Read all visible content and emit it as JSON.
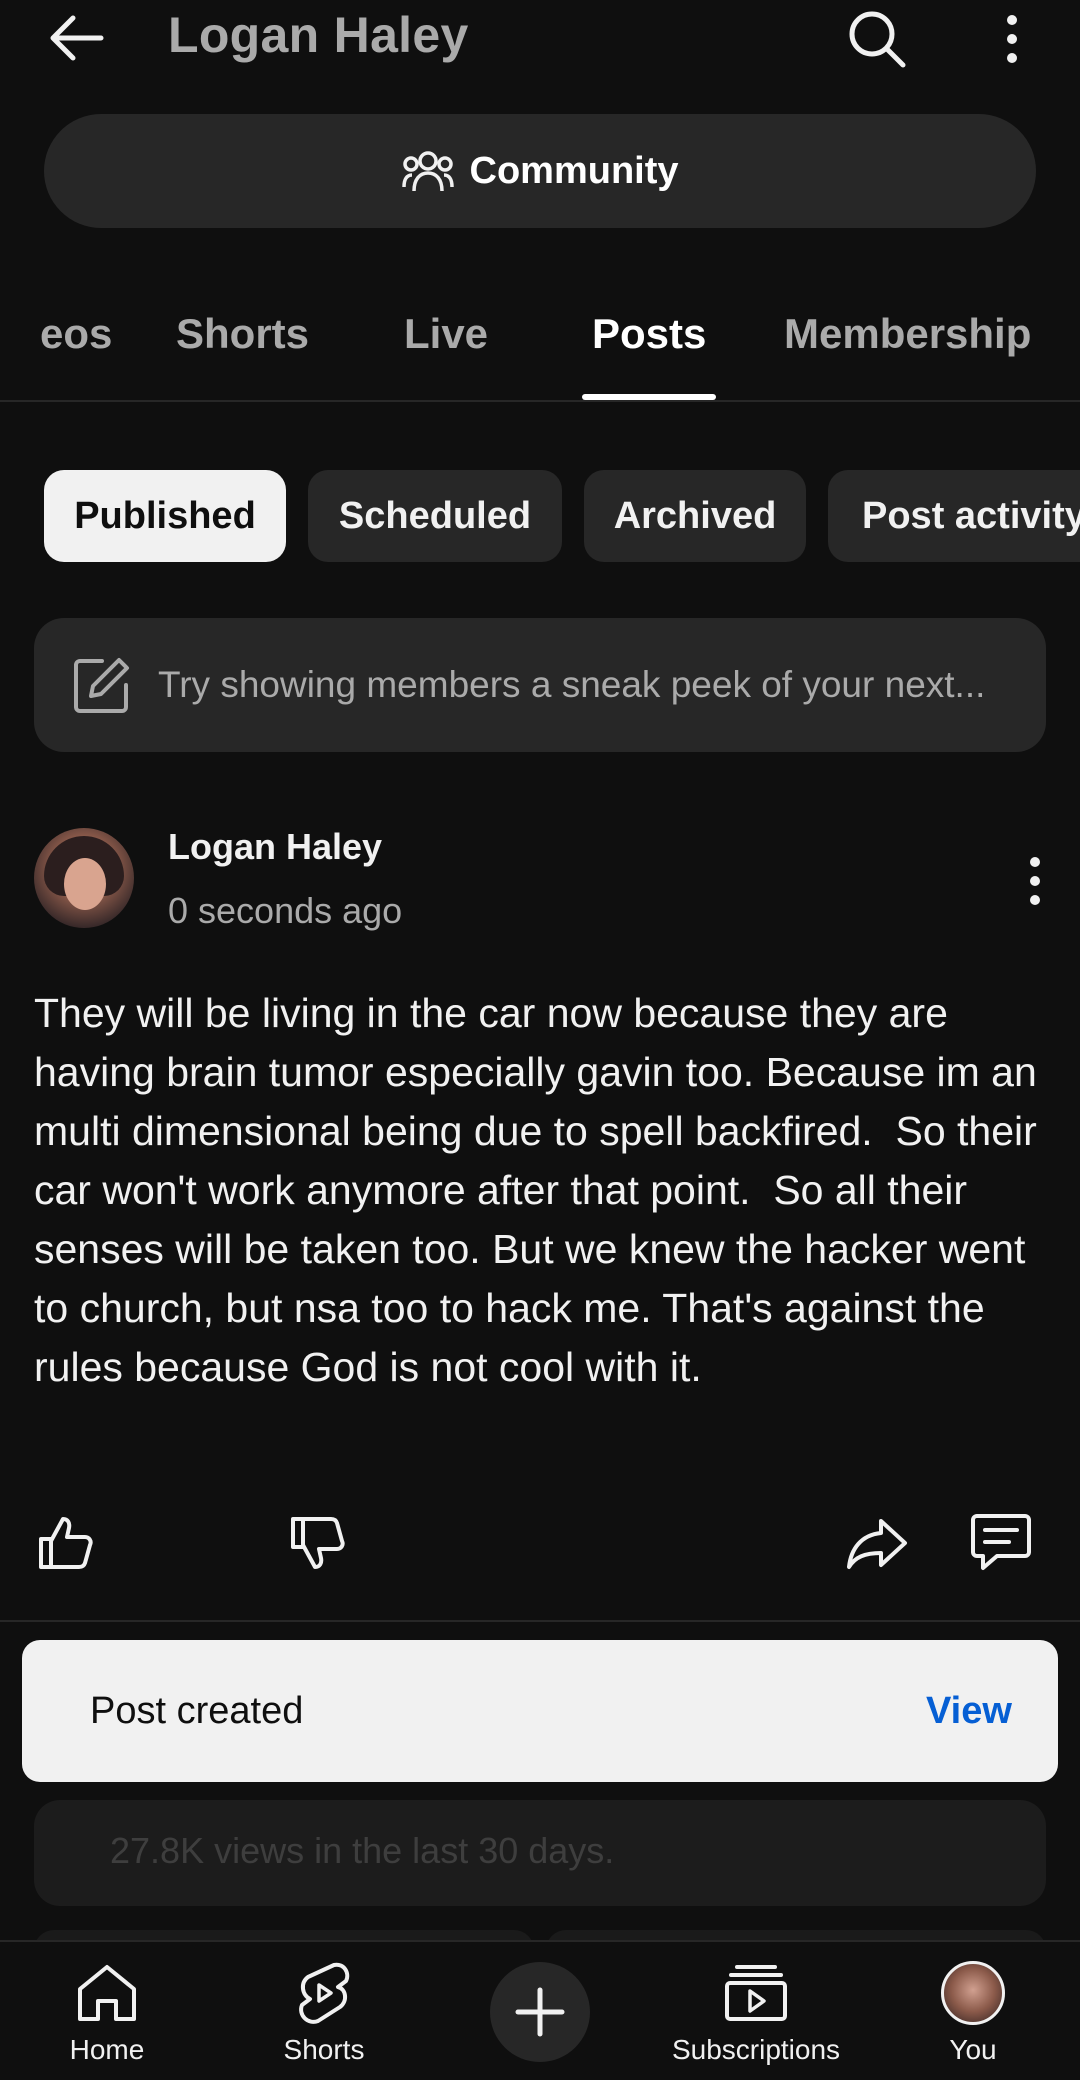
{
  "header": {
    "title": "Logan Haley",
    "community_label": "Community"
  },
  "tabs": [
    {
      "label": "eos",
      "active": false
    },
    {
      "label": "Shorts",
      "active": false
    },
    {
      "label": "Live",
      "active": false
    },
    {
      "label": "Posts",
      "active": true
    },
    {
      "label": "Membership",
      "active": false
    }
  ],
  "chips": [
    {
      "label": "Published",
      "active": true
    },
    {
      "label": "Scheduled",
      "active": false
    },
    {
      "label": "Archived",
      "active": false
    },
    {
      "label": "Post activity",
      "active": false
    }
  ],
  "composer": {
    "placeholder": "Try showing members a sneak peek of your next..."
  },
  "post": {
    "author": "Logan Haley",
    "time": "0 seconds ago",
    "body": "They will be living in the car now because they are having brain tumor especially gavin too. Because im an multi dimensional being due to spell backfired.  So their car won't work anymore after that point.  So all their senses will be taken too. But we knew the hacker went to church, but nsa too to hack me. That's against the rules because God is not cool with it."
  },
  "snackbar": {
    "message": "Post created",
    "action": "View"
  },
  "background_card": {
    "text": "27.8K views in the last 30 days."
  },
  "bottom_nav": {
    "home": "Home",
    "shorts": "Shorts",
    "subscriptions": "Subscriptions",
    "you": "You"
  },
  "colors": {
    "background": "#0f0f0f",
    "surface": "#272727",
    "accent_link": "#065fd4",
    "text_primary": "#f1f1f1",
    "text_secondary": "#aaaaaa"
  }
}
